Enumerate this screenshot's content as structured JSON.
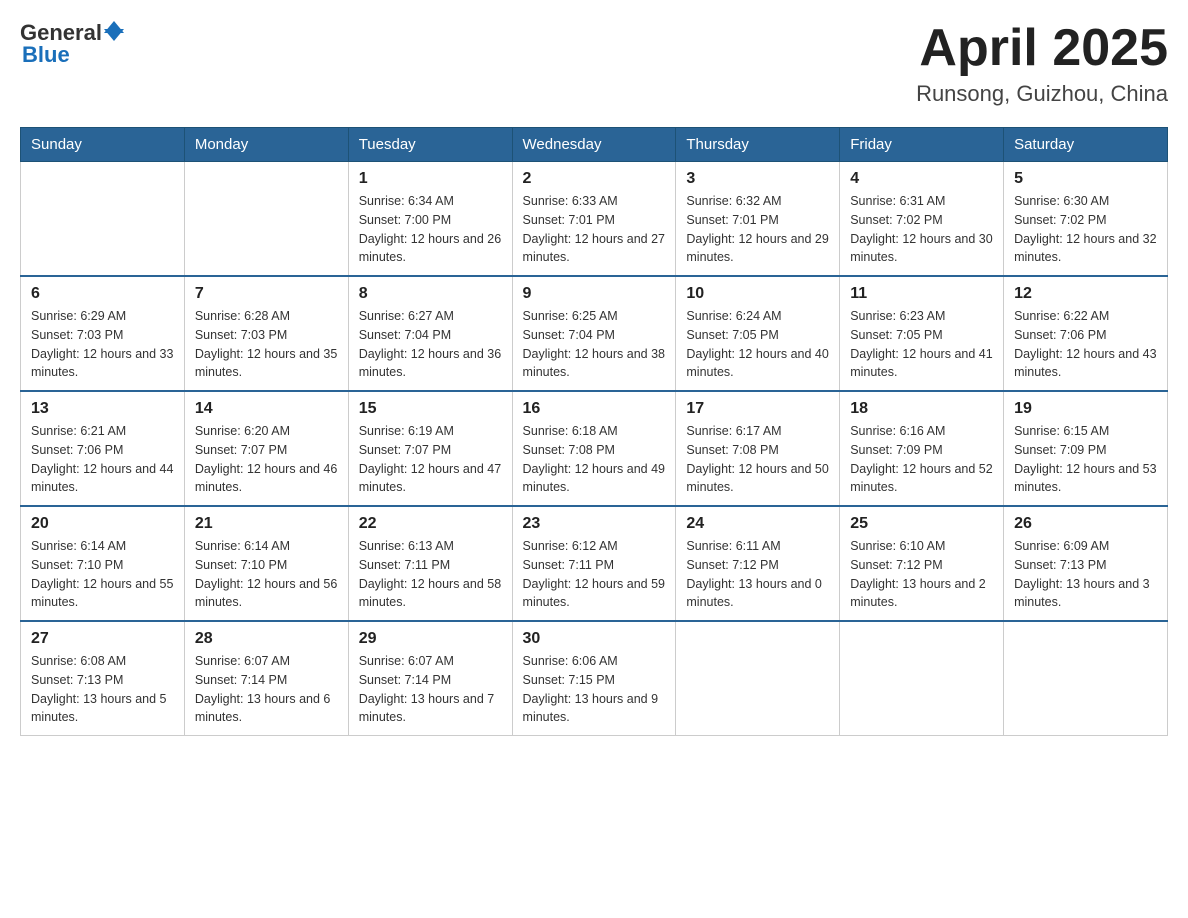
{
  "header": {
    "logo": {
      "text_general": "General",
      "text_blue": "Blue"
    },
    "title": "April 2025",
    "location": "Runsong, Guizhou, China"
  },
  "calendar": {
    "days_of_week": [
      "Sunday",
      "Monday",
      "Tuesday",
      "Wednesday",
      "Thursday",
      "Friday",
      "Saturday"
    ],
    "weeks": [
      [
        {
          "day": "",
          "sunrise": "",
          "sunset": "",
          "daylight": ""
        },
        {
          "day": "",
          "sunrise": "",
          "sunset": "",
          "daylight": ""
        },
        {
          "day": "1",
          "sunrise": "Sunrise: 6:34 AM",
          "sunset": "Sunset: 7:00 PM",
          "daylight": "Daylight: 12 hours and 26 minutes."
        },
        {
          "day": "2",
          "sunrise": "Sunrise: 6:33 AM",
          "sunset": "Sunset: 7:01 PM",
          "daylight": "Daylight: 12 hours and 27 minutes."
        },
        {
          "day": "3",
          "sunrise": "Sunrise: 6:32 AM",
          "sunset": "Sunset: 7:01 PM",
          "daylight": "Daylight: 12 hours and 29 minutes."
        },
        {
          "day": "4",
          "sunrise": "Sunrise: 6:31 AM",
          "sunset": "Sunset: 7:02 PM",
          "daylight": "Daylight: 12 hours and 30 minutes."
        },
        {
          "day": "5",
          "sunrise": "Sunrise: 6:30 AM",
          "sunset": "Sunset: 7:02 PM",
          "daylight": "Daylight: 12 hours and 32 minutes."
        }
      ],
      [
        {
          "day": "6",
          "sunrise": "Sunrise: 6:29 AM",
          "sunset": "Sunset: 7:03 PM",
          "daylight": "Daylight: 12 hours and 33 minutes."
        },
        {
          "day": "7",
          "sunrise": "Sunrise: 6:28 AM",
          "sunset": "Sunset: 7:03 PM",
          "daylight": "Daylight: 12 hours and 35 minutes."
        },
        {
          "day": "8",
          "sunrise": "Sunrise: 6:27 AM",
          "sunset": "Sunset: 7:04 PM",
          "daylight": "Daylight: 12 hours and 36 minutes."
        },
        {
          "day": "9",
          "sunrise": "Sunrise: 6:25 AM",
          "sunset": "Sunset: 7:04 PM",
          "daylight": "Daylight: 12 hours and 38 minutes."
        },
        {
          "day": "10",
          "sunrise": "Sunrise: 6:24 AM",
          "sunset": "Sunset: 7:05 PM",
          "daylight": "Daylight: 12 hours and 40 minutes."
        },
        {
          "day": "11",
          "sunrise": "Sunrise: 6:23 AM",
          "sunset": "Sunset: 7:05 PM",
          "daylight": "Daylight: 12 hours and 41 minutes."
        },
        {
          "day": "12",
          "sunrise": "Sunrise: 6:22 AM",
          "sunset": "Sunset: 7:06 PM",
          "daylight": "Daylight: 12 hours and 43 minutes."
        }
      ],
      [
        {
          "day": "13",
          "sunrise": "Sunrise: 6:21 AM",
          "sunset": "Sunset: 7:06 PM",
          "daylight": "Daylight: 12 hours and 44 minutes."
        },
        {
          "day": "14",
          "sunrise": "Sunrise: 6:20 AM",
          "sunset": "Sunset: 7:07 PM",
          "daylight": "Daylight: 12 hours and 46 minutes."
        },
        {
          "day": "15",
          "sunrise": "Sunrise: 6:19 AM",
          "sunset": "Sunset: 7:07 PM",
          "daylight": "Daylight: 12 hours and 47 minutes."
        },
        {
          "day": "16",
          "sunrise": "Sunrise: 6:18 AM",
          "sunset": "Sunset: 7:08 PM",
          "daylight": "Daylight: 12 hours and 49 minutes."
        },
        {
          "day": "17",
          "sunrise": "Sunrise: 6:17 AM",
          "sunset": "Sunset: 7:08 PM",
          "daylight": "Daylight: 12 hours and 50 minutes."
        },
        {
          "day": "18",
          "sunrise": "Sunrise: 6:16 AM",
          "sunset": "Sunset: 7:09 PM",
          "daylight": "Daylight: 12 hours and 52 minutes."
        },
        {
          "day": "19",
          "sunrise": "Sunrise: 6:15 AM",
          "sunset": "Sunset: 7:09 PM",
          "daylight": "Daylight: 12 hours and 53 minutes."
        }
      ],
      [
        {
          "day": "20",
          "sunrise": "Sunrise: 6:14 AM",
          "sunset": "Sunset: 7:10 PM",
          "daylight": "Daylight: 12 hours and 55 minutes."
        },
        {
          "day": "21",
          "sunrise": "Sunrise: 6:14 AM",
          "sunset": "Sunset: 7:10 PM",
          "daylight": "Daylight: 12 hours and 56 minutes."
        },
        {
          "day": "22",
          "sunrise": "Sunrise: 6:13 AM",
          "sunset": "Sunset: 7:11 PM",
          "daylight": "Daylight: 12 hours and 58 minutes."
        },
        {
          "day": "23",
          "sunrise": "Sunrise: 6:12 AM",
          "sunset": "Sunset: 7:11 PM",
          "daylight": "Daylight: 12 hours and 59 minutes."
        },
        {
          "day": "24",
          "sunrise": "Sunrise: 6:11 AM",
          "sunset": "Sunset: 7:12 PM",
          "daylight": "Daylight: 13 hours and 0 minutes."
        },
        {
          "day": "25",
          "sunrise": "Sunrise: 6:10 AM",
          "sunset": "Sunset: 7:12 PM",
          "daylight": "Daylight: 13 hours and 2 minutes."
        },
        {
          "day": "26",
          "sunrise": "Sunrise: 6:09 AM",
          "sunset": "Sunset: 7:13 PM",
          "daylight": "Daylight: 13 hours and 3 minutes."
        }
      ],
      [
        {
          "day": "27",
          "sunrise": "Sunrise: 6:08 AM",
          "sunset": "Sunset: 7:13 PM",
          "daylight": "Daylight: 13 hours and 5 minutes."
        },
        {
          "day": "28",
          "sunrise": "Sunrise: 6:07 AM",
          "sunset": "Sunset: 7:14 PM",
          "daylight": "Daylight: 13 hours and 6 minutes."
        },
        {
          "day": "29",
          "sunrise": "Sunrise: 6:07 AM",
          "sunset": "Sunset: 7:14 PM",
          "daylight": "Daylight: 13 hours and 7 minutes."
        },
        {
          "day": "30",
          "sunrise": "Sunrise: 6:06 AM",
          "sunset": "Sunset: 7:15 PM",
          "daylight": "Daylight: 13 hours and 9 minutes."
        },
        {
          "day": "",
          "sunrise": "",
          "sunset": "",
          "daylight": ""
        },
        {
          "day": "",
          "sunrise": "",
          "sunset": "",
          "daylight": ""
        },
        {
          "day": "",
          "sunrise": "",
          "sunset": "",
          "daylight": ""
        }
      ]
    ]
  }
}
